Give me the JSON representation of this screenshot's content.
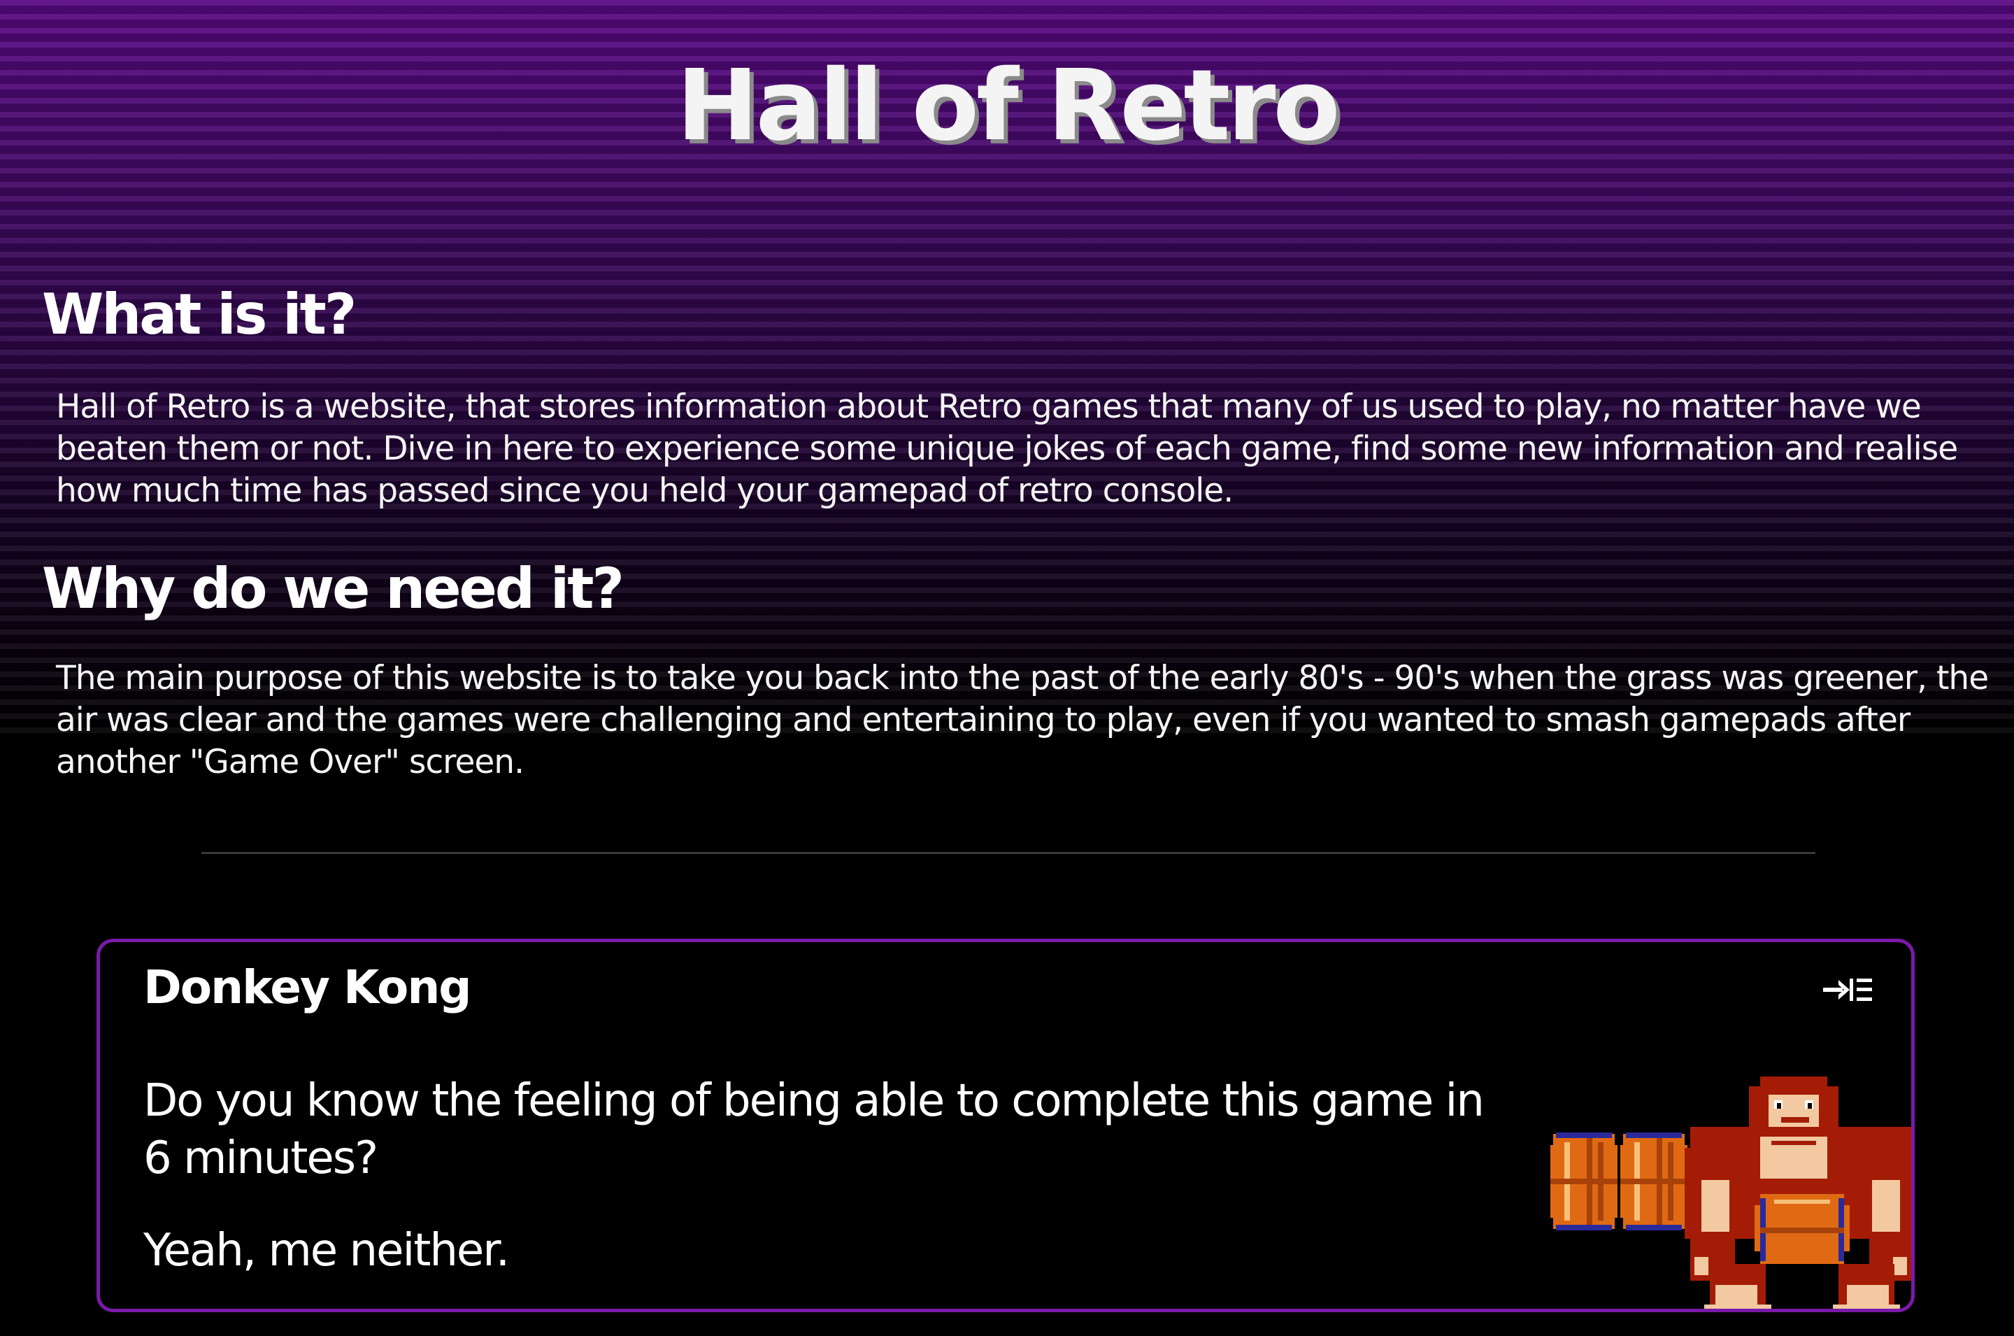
{
  "site": {
    "title": "Hall of Retro"
  },
  "sections": [
    {
      "heading": "What is it?",
      "text": "Hall of Retro is a website, that stores information about Retro games that many of us used to play, no matter have we beaten them or not. Dive in here to experience some unique jokes of each game, find some new information and realise how much time has passed since you held your gamepad of retro console."
    },
    {
      "heading": "Why do we need it?",
      "text": "The main purpose of this website is to take you back into the past of the early 80's - 90's when the grass was greener, the air was clear and the games were challenging and entertaining to play, even if you wanted to smash gamepads after another \"Game Over\" screen."
    }
  ],
  "game_card": {
    "title": "Donkey Kong",
    "question": "Do you know the feeling of being able to complete this game in 6 minutes?",
    "answer": "Yeah, me neither.",
    "expand_icon": "indent-expand-icon",
    "image": "donkey-kong-sprite-with-barrels",
    "border_color": "#7a1aa8"
  },
  "theme": {
    "stripe_top": "#5a0a85",
    "background": "#000000",
    "text": "#ffffff"
  }
}
